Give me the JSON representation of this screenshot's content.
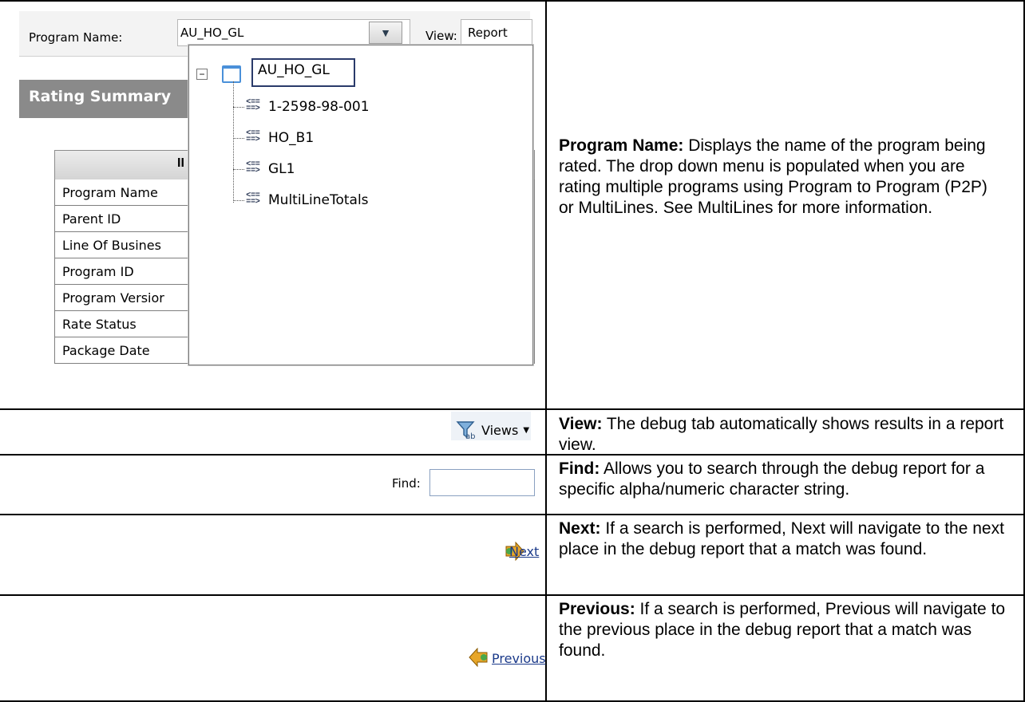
{
  "screenshot": {
    "program_name_label": "Program Name:",
    "program_name_value": "AU_HO_GL",
    "view_label": "View:",
    "view_value": "Report",
    "rating_summary_title": "Rating Summary",
    "grid_header_text": "II",
    "grid_rows": [
      "Program Name",
      "Parent ID",
      "Line Of Busines",
      "Program ID",
      "Program Versior",
      "Rate Status",
      "Package Date"
    ],
    "dropdown": {
      "root": "AU_HO_GL",
      "children": [
        "1-2598-98-001",
        "HO_B1",
        "GL1",
        "MultiLineTotals"
      ]
    },
    "views_button_label": "Views",
    "find_label": "Find:",
    "find_value": "",
    "next_label": "Next",
    "previous_label": "Previous"
  },
  "descriptions": {
    "program_name": {
      "term": "Program Name:",
      "text": " Displays the name of the program being rated. The drop down menu is populated when you are rating multiple programs using Program to Program (P2P) or MultiLines. See MultiLines for more information."
    },
    "view": {
      "term": "View:",
      "text": " The debug tab automatically shows results in a report view."
    },
    "find": {
      "term": "Find:",
      "text": " Allows you to search through the debug report for a specific alpha/numeric character string."
    },
    "next": {
      "term": "Next:",
      "text": " If a search is performed, Next will navigate to the next place in the debug report that a match was found."
    },
    "previous": {
      "term": "Previous:",
      "text": " If a search is performed, Previous will navigate to the previous place in the debug report that a match was found."
    }
  }
}
